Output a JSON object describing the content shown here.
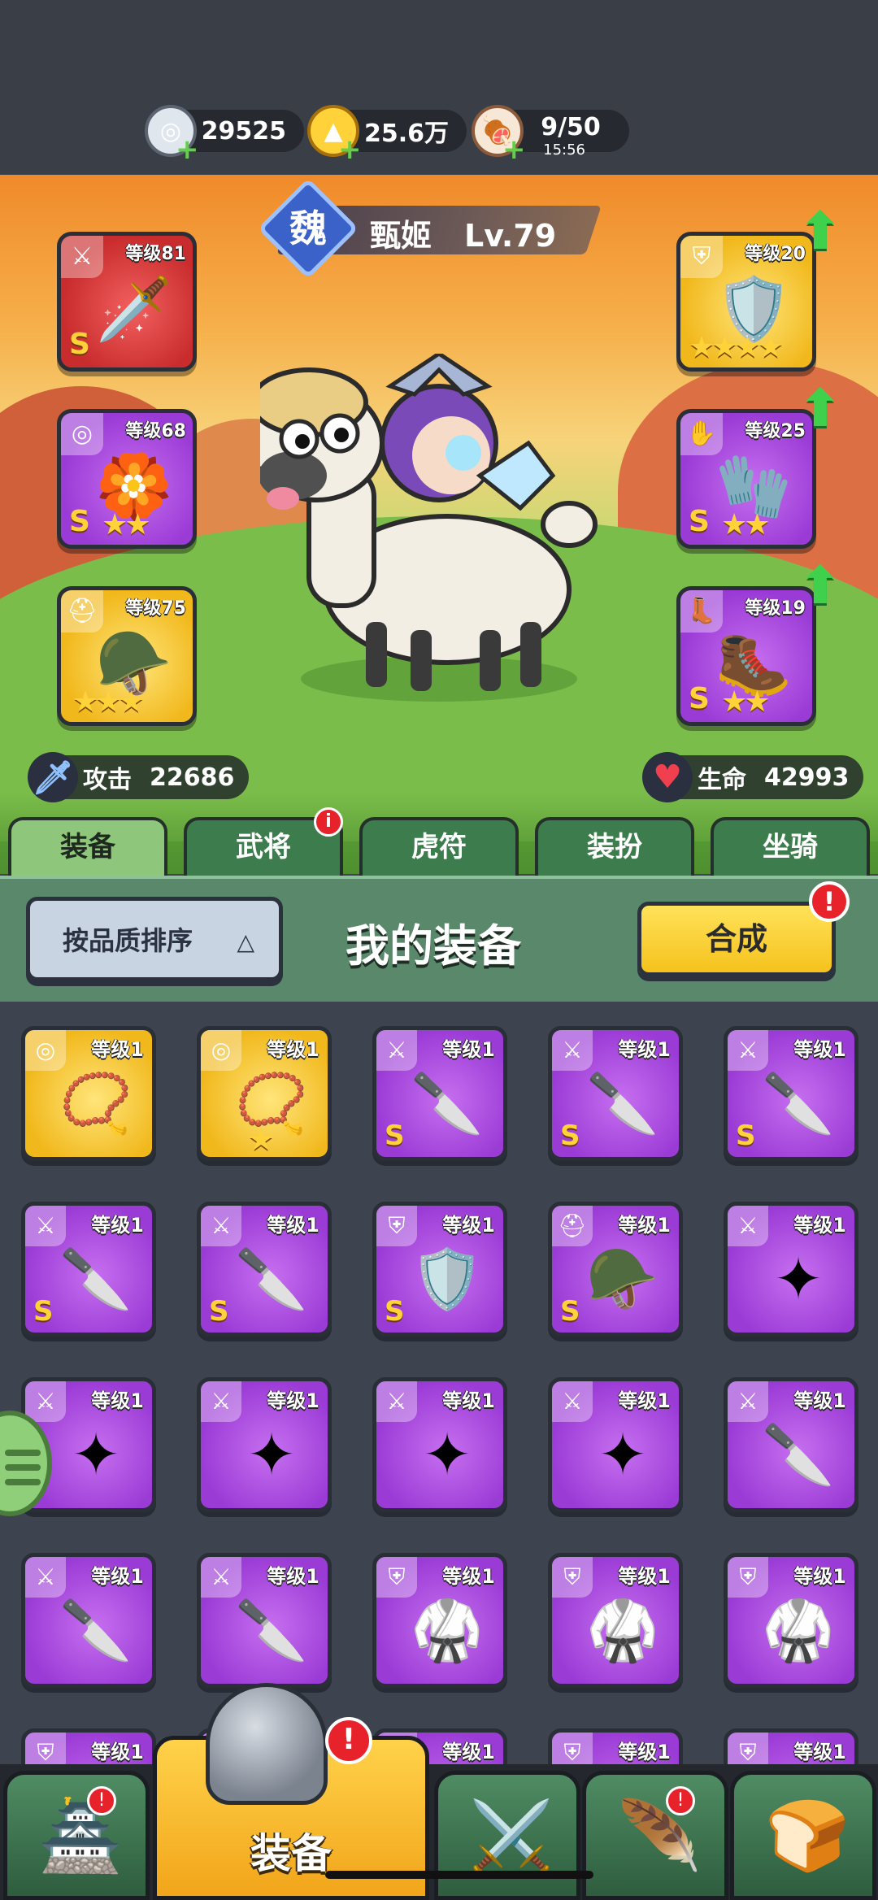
{
  "currency": {
    "silver": "29525",
    "gold": "25.6万",
    "stamina": "9/50",
    "stamina_timer": "15:56"
  },
  "hero": {
    "faction": "魏",
    "name": "甄姬",
    "level": "Lv.79",
    "attack_label": "攻击",
    "attack_value": "22686",
    "hp_label": "生命",
    "hp_value": "42993"
  },
  "equipped": [
    {
      "level": "等级81",
      "grade": "S",
      "stars": "",
      "color": "red",
      "tag": "⚔",
      "art": "🗡️"
    },
    {
      "level": "等级68",
      "grade": "S",
      "stars": "★★",
      "color": "purple",
      "tag": "◎",
      "art": "🏵️"
    },
    {
      "level": "等级75",
      "grade": "",
      "stars": "★★★",
      "color": "gold",
      "tag": "⛑",
      "art": "🪖"
    },
    {
      "level": "等级20",
      "grade": "",
      "stars": "★★★★",
      "color": "gold",
      "tag": "⛨",
      "art": "🛡️"
    },
    {
      "level": "等级25",
      "grade": "S",
      "stars": "★★",
      "color": "purple",
      "tag": "✋",
      "art": "🧤"
    },
    {
      "level": "等级19",
      "grade": "S",
      "stars": "★★",
      "color": "purple",
      "tag": "👢",
      "art": "🥾"
    }
  ],
  "tabs": [
    {
      "label": "装备",
      "active": true
    },
    {
      "label": "武将",
      "badge": "i"
    },
    {
      "label": "虎符"
    },
    {
      "label": "装扮"
    },
    {
      "label": "坐骑"
    }
  ],
  "panel": {
    "sort_label": "按品质排序",
    "title": "我的装备",
    "merge_label": "合成",
    "merge_badge": "!"
  },
  "inventory": [
    {
      "level": "等级1",
      "color": "gold",
      "tag": "◎",
      "art": "📿",
      "grade": ""
    },
    {
      "level": "等级1",
      "color": "gold",
      "tag": "◎",
      "art": "📿",
      "grade": "",
      "star": "★"
    },
    {
      "level": "等级1",
      "color": "purple",
      "tag": "⚔",
      "art": "🔪",
      "grade": "S"
    },
    {
      "level": "等级1",
      "color": "purple",
      "tag": "⚔",
      "art": "🔪",
      "grade": "S"
    },
    {
      "level": "等级1",
      "color": "purple",
      "tag": "⚔",
      "art": "🔪",
      "grade": "S"
    },
    {
      "level": "等级1",
      "color": "purple",
      "tag": "⚔",
      "art": "🔪",
      "grade": "S"
    },
    {
      "level": "等级1",
      "color": "purple",
      "tag": "⚔",
      "art": "🔪",
      "grade": "S"
    },
    {
      "level": "等级1",
      "color": "purple",
      "tag": "⛨",
      "art": "🛡️",
      "grade": "S"
    },
    {
      "level": "等级1",
      "color": "purple",
      "tag": "⛑",
      "art": "🪖",
      "grade": "S"
    },
    {
      "level": "等级1",
      "color": "purple",
      "tag": "⚔",
      "art": "✦",
      "grade": ""
    },
    {
      "level": "等级1",
      "color": "purple",
      "tag": "⚔",
      "art": "✦",
      "grade": ""
    },
    {
      "level": "等级1",
      "color": "purple",
      "tag": "⚔",
      "art": "✦",
      "grade": ""
    },
    {
      "level": "等级1",
      "color": "purple",
      "tag": "⚔",
      "art": "✦",
      "grade": ""
    },
    {
      "level": "等级1",
      "color": "purple",
      "tag": "⚔",
      "art": "✦",
      "grade": ""
    },
    {
      "level": "等级1",
      "color": "purple",
      "tag": "⚔",
      "art": "🔪",
      "grade": ""
    },
    {
      "level": "等级1",
      "color": "purple",
      "tag": "⚔",
      "art": "🔪",
      "grade": ""
    },
    {
      "level": "等级1",
      "color": "purple",
      "tag": "⚔",
      "art": "🔪",
      "grade": ""
    },
    {
      "level": "等级1",
      "color": "purple",
      "tag": "⛨",
      "art": "🥋",
      "grade": ""
    },
    {
      "level": "等级1",
      "color": "purple",
      "tag": "⛨",
      "art": "🥋",
      "grade": ""
    },
    {
      "level": "等级1",
      "color": "purple",
      "tag": "⛨",
      "art": "🥋",
      "grade": ""
    },
    {
      "level": "等级1",
      "color": "purple",
      "tag": "⛨",
      "art": "",
      "grade": ""
    },
    {
      "level": "等级1",
      "color": "purple",
      "tag": "⛨",
      "art": "",
      "grade": ""
    },
    {
      "level": "等级1",
      "color": "purple",
      "tag": "⛨",
      "art": "",
      "grade": ""
    },
    {
      "level": "等级1",
      "color": "purple",
      "tag": "⛨",
      "art": "",
      "grade": ""
    },
    {
      "level": "等级1",
      "color": "purple",
      "tag": "⛨",
      "art": "",
      "grade": ""
    }
  ],
  "bottom_nav": [
    {
      "name": "castle",
      "icon": "🏯",
      "badge": "!"
    },
    {
      "name": "equipment",
      "label": "装备",
      "active": true,
      "badge": "!"
    },
    {
      "name": "arena",
      "icon": "⚔️"
    },
    {
      "name": "heroes",
      "icon": "🪶",
      "badge": "!"
    },
    {
      "name": "upgrade",
      "icon": "🍞"
    }
  ]
}
